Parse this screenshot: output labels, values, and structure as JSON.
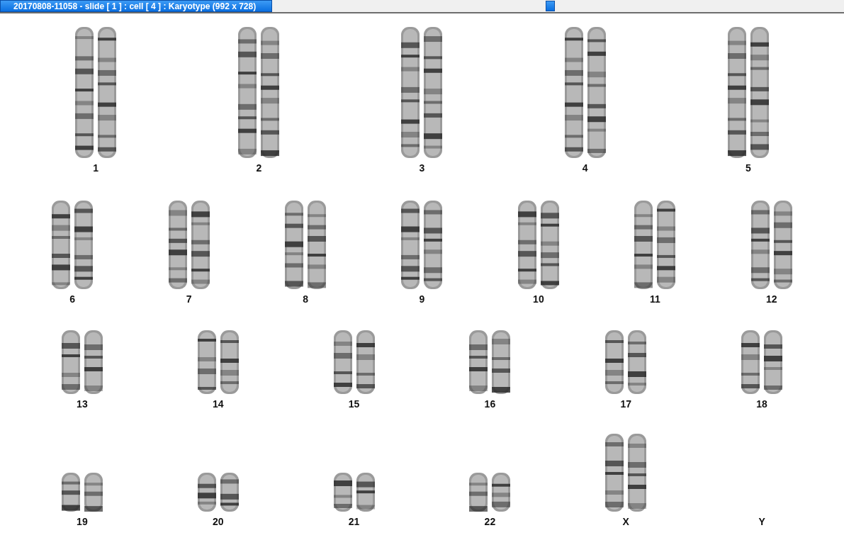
{
  "window": {
    "title": "20170808-11058 - slide [ 1 ] : cell [ 4 ] : Karyotype  (992 x 728)"
  },
  "rows": [
    {
      "items": [
        {
          "label": "1",
          "kind": "pair"
        },
        {
          "label": "2",
          "kind": "pair"
        },
        {
          "label": "3",
          "kind": "pair"
        },
        {
          "label": "4",
          "kind": "pair"
        },
        {
          "label": "5",
          "kind": "pair"
        }
      ]
    },
    {
      "items": [
        {
          "label": "6",
          "kind": "pair"
        },
        {
          "label": "7",
          "kind": "pair"
        },
        {
          "label": "8",
          "kind": "pair"
        },
        {
          "label": "9",
          "kind": "pair"
        },
        {
          "label": "10",
          "kind": "pair"
        },
        {
          "label": "11",
          "kind": "pair"
        },
        {
          "label": "12",
          "kind": "pair"
        }
      ]
    },
    {
      "items": [
        {
          "label": "13",
          "kind": "pair"
        },
        {
          "label": "14",
          "kind": "pair"
        },
        {
          "label": "15",
          "kind": "pair"
        },
        {
          "label": "16",
          "kind": "pair"
        },
        {
          "label": "17",
          "kind": "pair"
        },
        {
          "label": "18",
          "kind": "pair"
        }
      ]
    },
    {
      "items": [
        {
          "label": "19",
          "kind": "pair"
        },
        {
          "label": "20",
          "kind": "pair"
        },
        {
          "label": "21",
          "kind": "pair"
        },
        {
          "label": "22",
          "kind": "pair"
        },
        {
          "label": "X",
          "kind": "long-pair"
        },
        {
          "label": "Y",
          "kind": "empty"
        }
      ]
    }
  ]
}
